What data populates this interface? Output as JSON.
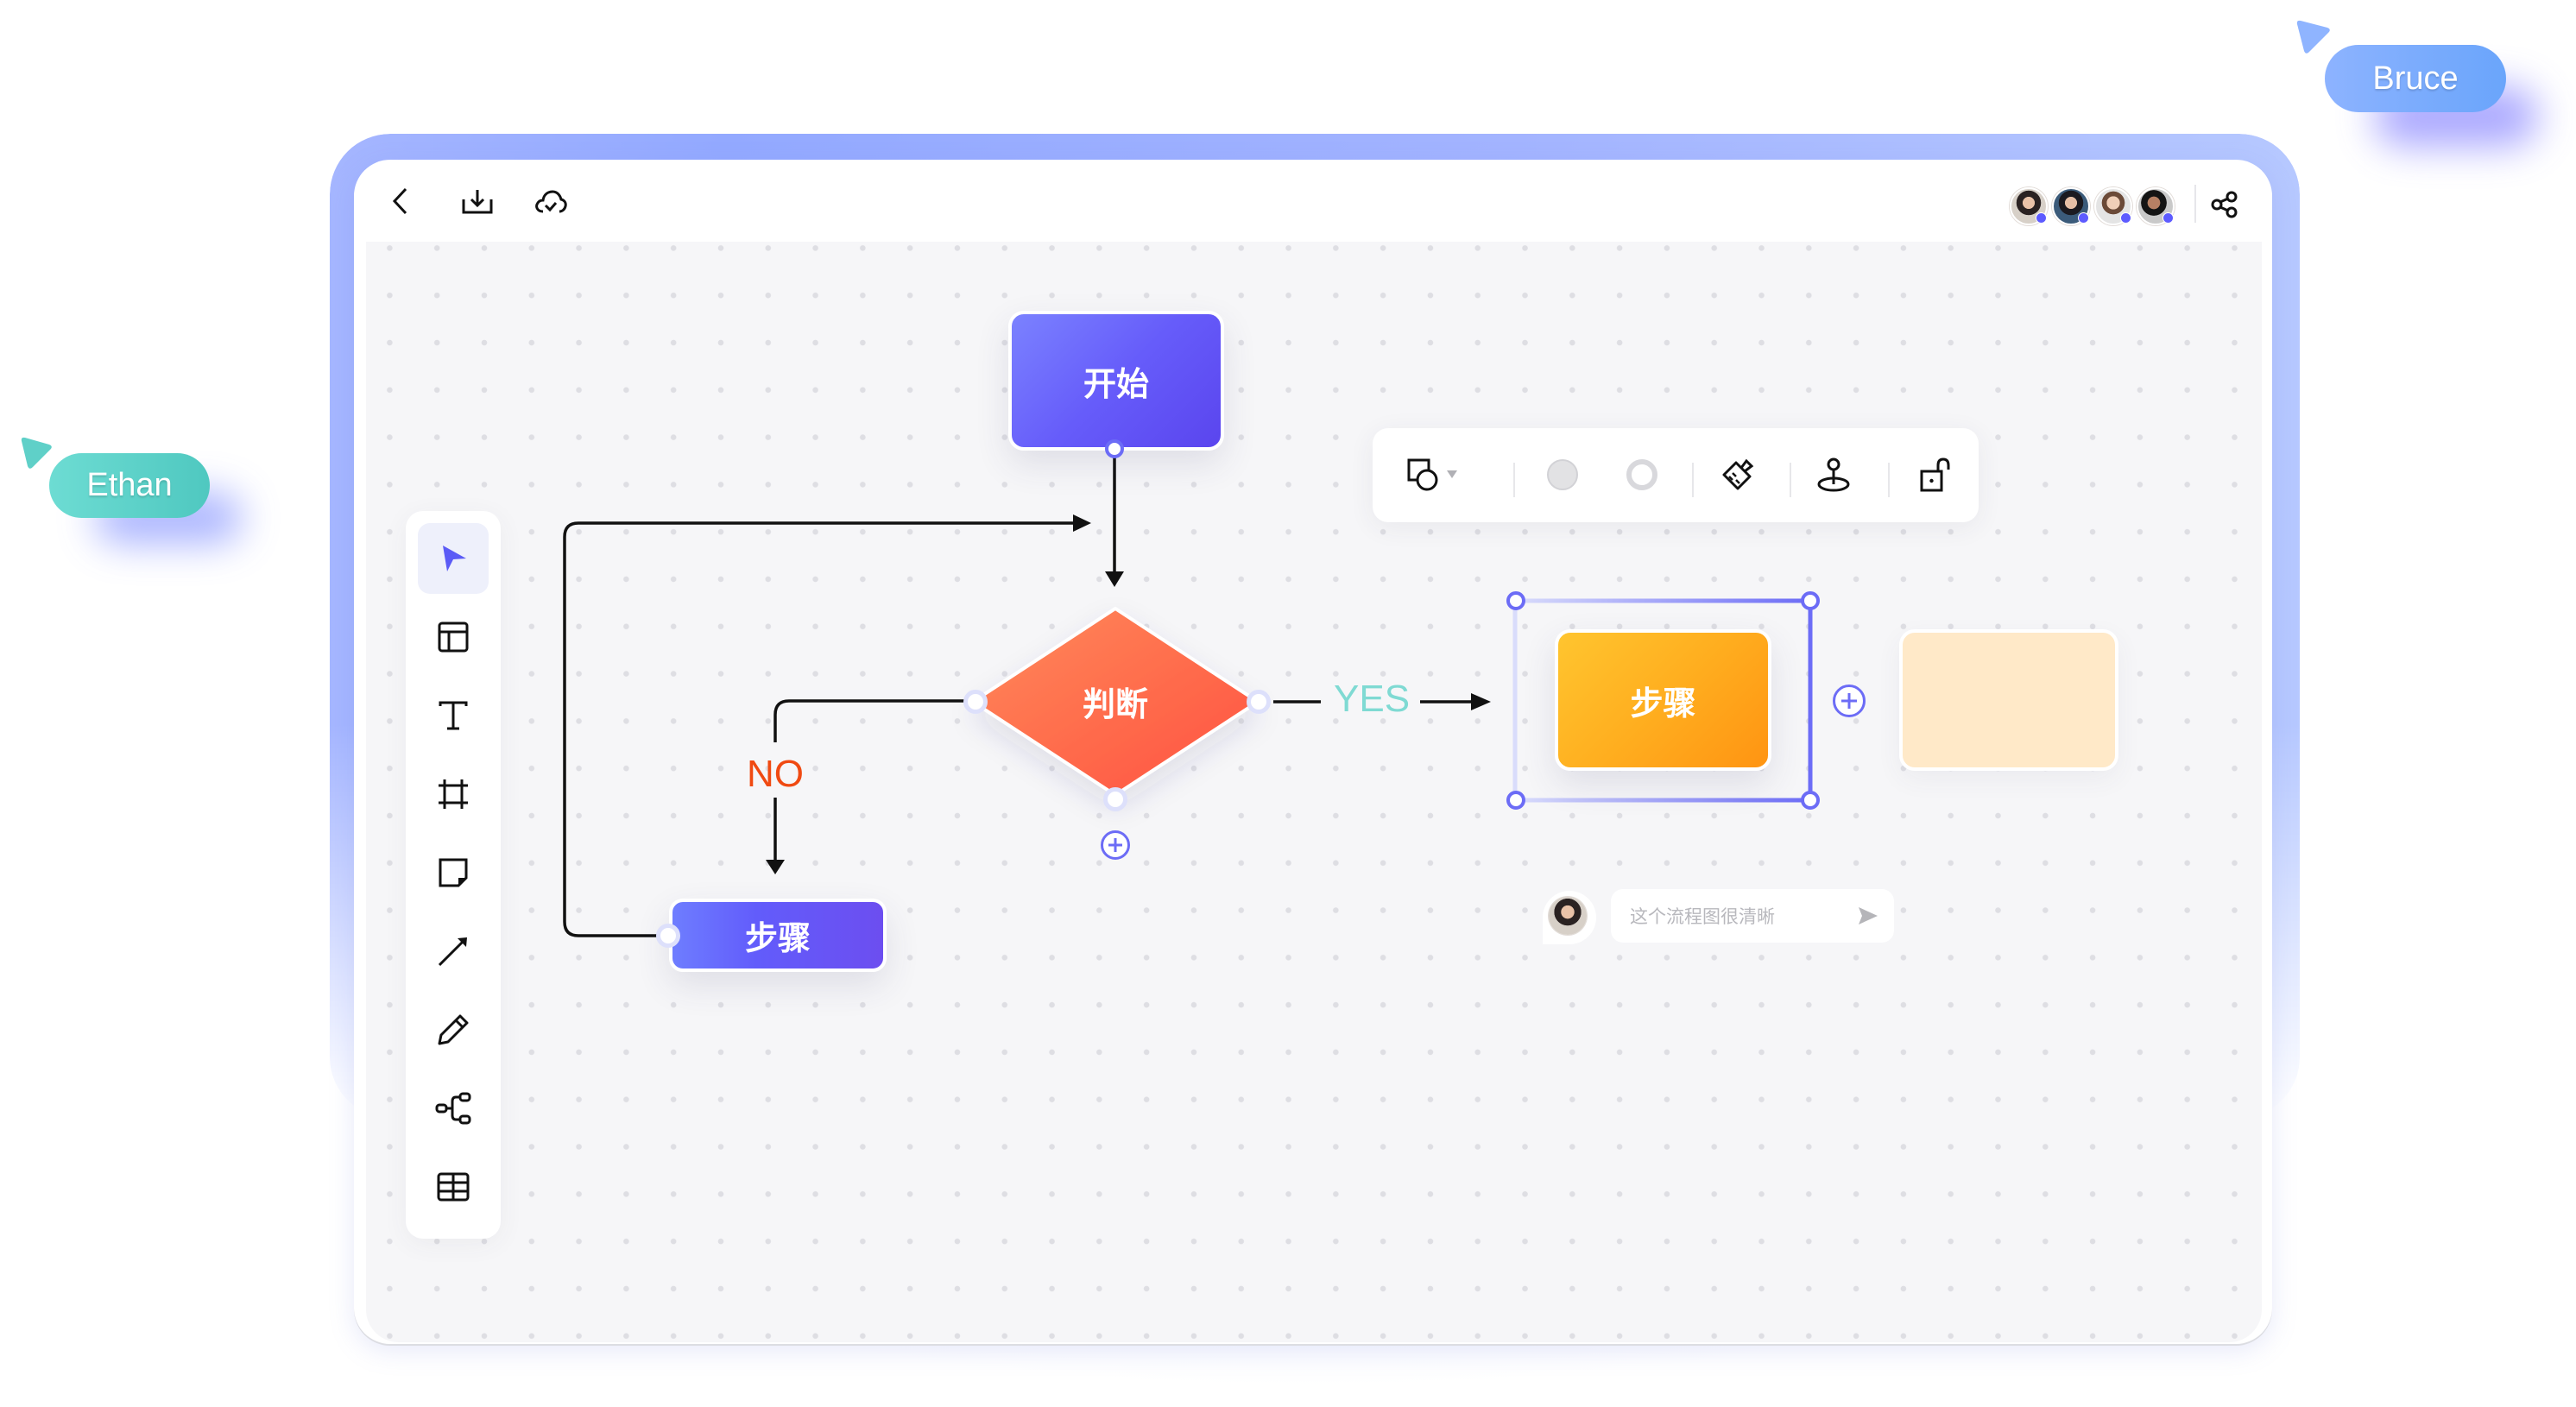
{
  "collaborators_cursors": [
    {
      "name": "Bruce",
      "color": "#77a8ff"
    },
    {
      "name": "Ethan",
      "color": "#5dd3c9"
    }
  ],
  "header": {
    "left_icons": [
      "back-icon",
      "download-icon",
      "cloud-saved-icon"
    ],
    "avatars": [
      {
        "name": "collaborator-1",
        "status": "online"
      },
      {
        "name": "collaborator-2",
        "status": "online"
      },
      {
        "name": "collaborator-3",
        "status": "online"
      },
      {
        "name": "collaborator-4",
        "status": "online"
      }
    ],
    "share_icon": "share-icon"
  },
  "left_toolbar": {
    "tools": [
      {
        "id": "select",
        "icon": "cursor-arrow-icon",
        "active": true
      },
      {
        "id": "template",
        "icon": "layout-template-icon",
        "active": false
      },
      {
        "id": "text",
        "icon": "text-icon",
        "active": false
      },
      {
        "id": "frame",
        "icon": "frame-icon",
        "active": false
      },
      {
        "id": "sticky-note",
        "icon": "sticky-note-icon",
        "active": false
      },
      {
        "id": "connector",
        "icon": "arrow-line-icon",
        "active": false
      },
      {
        "id": "pen",
        "icon": "pen-icon",
        "active": false
      },
      {
        "id": "mind-map",
        "icon": "mind-map-icon",
        "active": false
      },
      {
        "id": "table",
        "icon": "table-icon",
        "active": false
      }
    ]
  },
  "floating_toolbar": {
    "items": [
      "shape-icon",
      "dropdown-caret-icon",
      "fill-color-icon",
      "border-color-icon",
      "format-brush-icon",
      "anchor-icon",
      "unlock-icon"
    ]
  },
  "flowchart": {
    "nodes": [
      {
        "id": "start",
        "label": "开始",
        "shape": "rounded-rect",
        "colors": [
          "#7b80ff",
          "#5d4ff2"
        ]
      },
      {
        "id": "decision",
        "label": "判断",
        "shape": "diamond",
        "colors": [
          "#ff8a5a",
          "#ff5a45"
        ]
      },
      {
        "id": "step-no",
        "label": "步骤",
        "shape": "rounded-rect",
        "colors": [
          "#6f79ff",
          "#6a4ff0"
        ]
      },
      {
        "id": "step-yes",
        "label": "步骤",
        "shape": "rounded-rect",
        "selected": true,
        "colors": [
          "#ffc22e",
          "#ff9a12"
        ]
      },
      {
        "id": "placeholder",
        "label": "",
        "shape": "rounded-rect",
        "colors": [
          "#ffe9c8",
          "#ffe9c8"
        ]
      }
    ],
    "edges": [
      {
        "from": "start",
        "to": "decision",
        "label": ""
      },
      {
        "from": "decision",
        "to": "step-yes",
        "label": "YES",
        "label_color": "#7fdad3"
      },
      {
        "from": "decision",
        "to": "step-no",
        "label": "NO",
        "label_color": "#f04a12"
      },
      {
        "from": "step-no",
        "to": "decision",
        "label": ""
      }
    ]
  },
  "comment": {
    "placeholder": "这个流程图很清晰",
    "send_icon": "send-icon"
  }
}
